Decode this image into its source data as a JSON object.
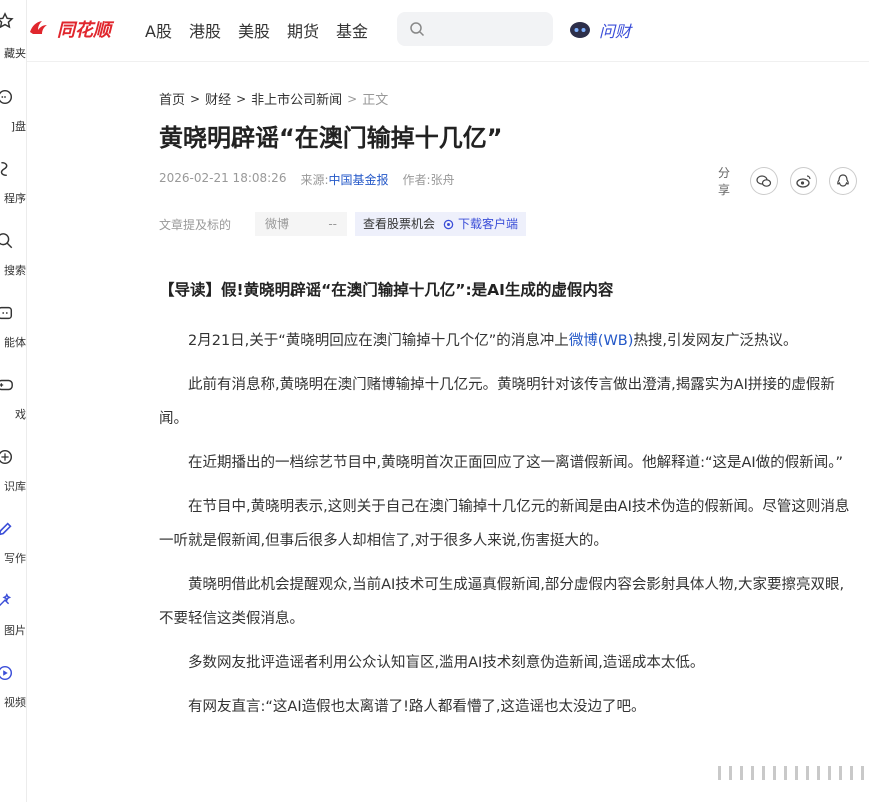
{
  "sidebar": {
    "items": [
      {
        "label": "藏夹",
        "icon": "star-icon"
      },
      {
        "label": "]盘",
        "icon": "chat-icon"
      },
      {
        "label": "程序",
        "icon": "bolt-icon"
      },
      {
        "label": "搜索",
        "icon": "search-icon"
      },
      {
        "label": "能体",
        "icon": "robot-icon"
      },
      {
        "label": "戏",
        "icon": "gamepad-icon"
      },
      {
        "label": "识库",
        "icon": "book-icon"
      },
      {
        "label": "写作",
        "icon": "pen-icon"
      },
      {
        "label": "图片",
        "icon": "image-sparkle-icon"
      },
      {
        "label": "视频",
        "icon": "video-icon"
      }
    ]
  },
  "header": {
    "logo_text": "同花顺",
    "nav": [
      "A股",
      "港股",
      "美股",
      "期货",
      "基金"
    ],
    "search_placeholder": "",
    "wencai_label": "问财"
  },
  "breadcrumb": {
    "items": [
      "首页",
      "财经",
      "非上市公司新闻"
    ],
    "current": "正文"
  },
  "article": {
    "title": "黄晓明辟谣“在澳门输掉十几亿”",
    "date": "2026-02-21 18:08:26",
    "source_label": "来源:",
    "source": "中国基金报",
    "author_label": "作者:",
    "author": "张舟",
    "share_label": "分享",
    "stocks_label": "文章提及标的",
    "stock_name": "微博",
    "stock_value": "--",
    "opportunity_label": "查看股票机会",
    "download_label": "下载客户端",
    "lead": "【导读】假!黄晓明辟谣“在澳门输掉十几亿”:是AI生成的虚假内容",
    "p1_before": "2月21日,关于“黄晓明回应在澳门输掉十几个亿”的消息冲上",
    "p1_link": "微博(WB)",
    "p1_after": "热搜,引发网友广泛热议。",
    "paragraphs": [
      "此前有消息称,黄晓明在澳门赌博输掉十几亿元。黄晓明针对该传言做出澄清,揭露实为AI拼接的虚假新闻。",
      "在近期播出的一档综艺节目中,黄晓明首次正面回应了这一离谱假新闻。他解释道:“这是AI做的假新闻。”",
      "在节目中,黄晓明表示,这则关于自己在澳门输掉十几亿元的新闻是由AI技术伪造的假新闻。尽管这则消息一听就是假新闻,但事后很多人却相信了,对于很多人来说,伤害挺大的。",
      "黄晓明借此机会提醒观众,当前AI技术可生成逼真假新闻,部分虚假内容会影射具体人物,大家要擦亮双眼,不要轻信这类假消息。",
      "多数网友批评造谣者利用公众认知盲区,滥用AI技术刻意伪造新闻,造谣成本太低。",
      "有网友直言:“这AI造假也太离谱了!路人都看懵了,这造谣也太没边了吧。"
    ]
  },
  "colors": {
    "brand_red": "#e0262d",
    "link_blue": "#2458c8",
    "wencai_blue": "#3b4ed8"
  }
}
